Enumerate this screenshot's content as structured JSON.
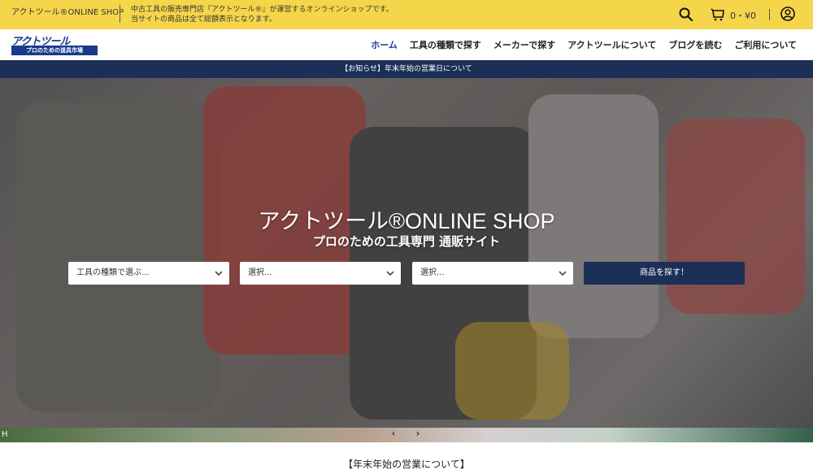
{
  "topbar": {
    "shop_name": "アクトツール®ONLINE SHOP",
    "description_line1": "中古工具の販売専門店『アクトツール®』が運営するオンラインショップです。",
    "description_line2": "当サイトの商品は全て総額表示となります。",
    "cart_count": "0・¥0",
    "icons": {
      "search": "search-icon",
      "cart": "cart-icon",
      "account": "account-icon"
    }
  },
  "header": {
    "logo_top": "アクトツール",
    "logo_sub": "プロのための道具市場",
    "nav": [
      {
        "label": "ホーム",
        "active": true
      },
      {
        "label": "工具の種類で探す"
      },
      {
        "label": "メーカーで探す"
      },
      {
        "label": "アクトツールについて"
      },
      {
        "label": "ブログを読む"
      },
      {
        "label": "ご利用について"
      }
    ]
  },
  "notice": {
    "text": "【お知らせ】年末年始の営業日について"
  },
  "hero": {
    "title": "アクトツール®ONLINE SHOP",
    "subtitle": "プロのための工具専門 通販サイト",
    "select1": "工具の種類で選ぶ...",
    "select2": "選択...",
    "select3": "選択...",
    "search_button": "商品を探す！"
  },
  "strip": {
    "broken_alt": "H",
    "prev": "‹",
    "next": "›"
  },
  "section": {
    "title": "【年末年始の営業について】"
  },
  "colors": {
    "topbar_bg": "#f5d54a",
    "brand_navy": "#1b2f57",
    "logo_blue": "#1b3a8c"
  }
}
